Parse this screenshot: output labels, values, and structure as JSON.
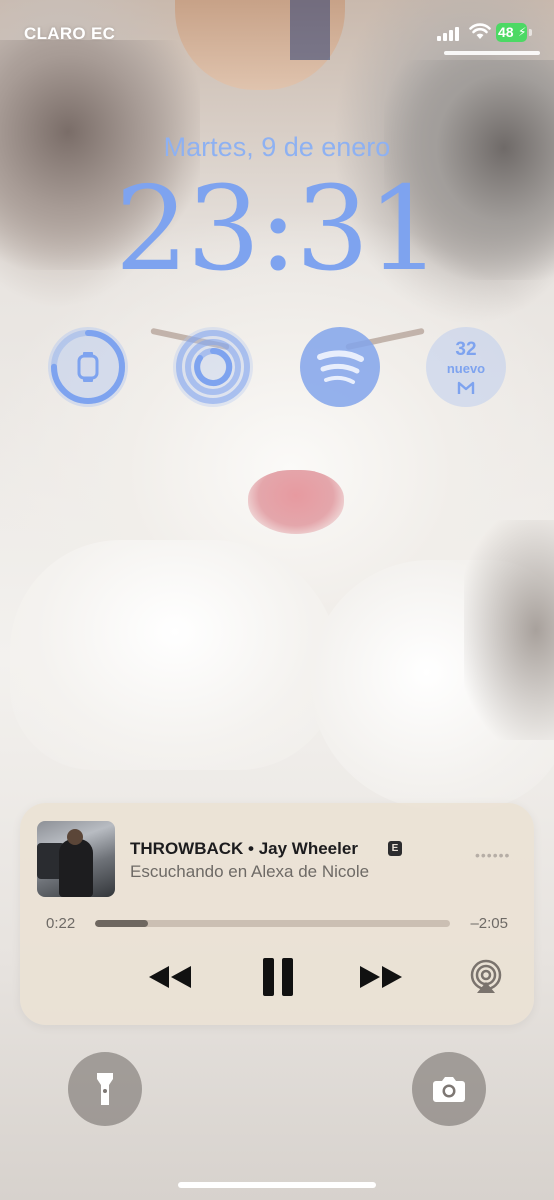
{
  "status_bar": {
    "carrier": "CLARO EC",
    "battery_percent": "48",
    "battery_color": "#4cd964",
    "icons": [
      "cellular-signal-icon",
      "wifi-icon",
      "battery-charging-icon"
    ]
  },
  "lock_screen": {
    "date": "Martes, 9 de enero",
    "time": "23:31",
    "accent_color": "#7ea3ef"
  },
  "widgets": [
    {
      "name": "watch-battery",
      "icon": "apple-watch-icon",
      "ring_level": 0.75
    },
    {
      "name": "fitness-rings",
      "icon": "activity-rings-icon"
    },
    {
      "name": "spotify",
      "icon": "spotify-icon"
    },
    {
      "name": "mail",
      "icon": "gmail-icon",
      "count": "32",
      "label": "nuevo"
    }
  ],
  "now_playing": {
    "title": "THROWBACK • Jay Wheeler",
    "explicit_badge": "E",
    "subtitle": "Escuchando en Alexa de Nicole",
    "elapsed": "0:22",
    "remaining": "–2:05",
    "progress": 0.15,
    "controls": [
      "rewind-icon",
      "pause-icon",
      "fast-forward-icon",
      "airplay-icon"
    ]
  },
  "quick_actions": [
    "flashlight-icon",
    "camera-icon"
  ]
}
